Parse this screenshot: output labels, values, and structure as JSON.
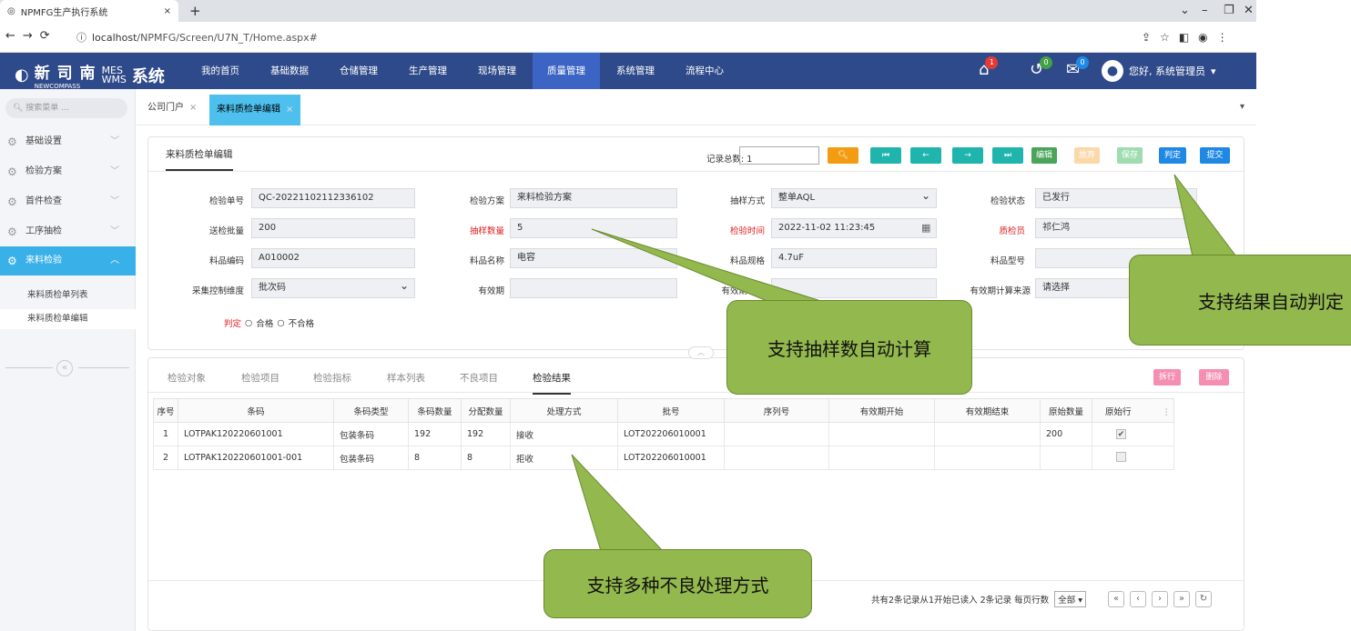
{
  "browser": {
    "tab_title": "NPMFG生产执行系统",
    "tab_close": "×",
    "new_tab": "+",
    "url_host": "localhost",
    "url_path": "/NPMFG/Screen/U7N_T/Home.aspx#",
    "win_min": "–",
    "win_max": "❐",
    "win_close": "✕"
  },
  "header": {
    "logo_cn": "新 司 南",
    "logo_en": "NEWCOMPASS",
    "logo_mes": "MES",
    "logo_wms": "WMS",
    "logo_system": "系统",
    "nav": [
      "我的首页",
      "基础数据",
      "仓储管理",
      "生产管理",
      "现场管理",
      "质量管理",
      "系统管理",
      "流程中心"
    ],
    "active_nav": "质量管理",
    "badge_home": "1",
    "badge_history": "0",
    "badge_mail": "0",
    "user_greeting": "您好, 系统管理员",
    "badge_colors": {
      "red": "#e53935",
      "green": "#43a047",
      "blue": "#1e88e5"
    }
  },
  "sidebar": {
    "search_placeholder": "搜索菜单 ...",
    "items": [
      "基础设置",
      "检验方案",
      "首件检查",
      "工序抽检",
      "来料检验"
    ],
    "sub_items": [
      "来料质检单列表",
      "来料质检单编辑"
    ]
  },
  "page_tabs": {
    "home": "公司门户",
    "current": "来料质检单编辑",
    "close": "×"
  },
  "form": {
    "title": "来料质检单编辑",
    "record_total_label": "记录总数: 1",
    "buttons": {
      "edit": "编辑",
      "discard": "放弃",
      "save": "保存",
      "judge": "判定",
      "submit": "提交"
    },
    "fields": {
      "inspect_no_label": "检验单号",
      "inspect_no": "QC-20221102112336102",
      "scheme_label": "检验方案",
      "scheme": "来料检验方案",
      "sampling_label": "抽样方式",
      "sampling": "整单AQL",
      "status_label": "检验状态",
      "status": "已发行",
      "batch_label": "送检批量",
      "batch": "200",
      "sample_qty_label": "抽样数量",
      "sample_qty": "5",
      "inspect_time_label": "检验时间",
      "inspect_time": "2022-11-02 11:23:45",
      "inspector_label": "质检员",
      "inspector": "祁仁鸿",
      "item_code_label": "料品编码",
      "item_code": "A010002",
      "item_name_label": "料品名称",
      "item_name": "电容",
      "item_spec_label": "料品规格",
      "item_spec": "4.7uF",
      "item_model_label": "料品型号",
      "item_model": "",
      "collect_label": "采集控制维度",
      "collect": "批次码",
      "validity_label": "有效期",
      "validity": "",
      "validity_unit_label": "有效期单位",
      "validity_unit": "",
      "validity_source_label": "有效期计算来源",
      "validity_source": "请选择",
      "judge_label": "判定",
      "pass": "合格",
      "fail": "不合格"
    }
  },
  "grid": {
    "tabs": [
      "检验对象",
      "检验项目",
      "检验指标",
      "样本列表",
      "不良项目",
      "检验结果"
    ],
    "active_tab": "检验结果",
    "split_btn": "拆行",
    "delete_btn": "删除",
    "columns": [
      "序号",
      "条码",
      "条码类型",
      "条码数量",
      "分配数量",
      "处理方式",
      "批号",
      "序列号",
      "有效期开始",
      "有效期结束",
      "原始数量",
      "原始行"
    ],
    "more": "⋮",
    "rows": [
      [
        "1",
        "LOTPAK120220601001",
        "包装条码",
        "192",
        "192",
        "接收",
        "LOT202206010001",
        "",
        "",
        "",
        "200",
        "✔"
      ],
      [
        "2",
        "LOTPAK120220601001-001",
        "包装条码",
        "8",
        "8",
        "拒收",
        "LOT202206010001",
        "",
        "",
        "",
        "",
        ""
      ]
    ],
    "pager_text": "共有2条记录从1开始已读入 2条记录 每页行数",
    "page_size": "全部"
  },
  "callouts": {
    "auto_judge": "支持结果自动判定",
    "auto_sample": "支持抽样数自动计算",
    "defect_handling": "支持多种不良处理方式"
  }
}
